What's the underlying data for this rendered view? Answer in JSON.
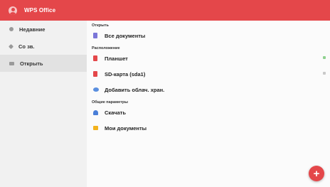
{
  "app": {
    "title": "WPS Office",
    "accent": "#e4474a"
  },
  "sidebar": {
    "items": [
      {
        "label": "Недавние",
        "icon": "clock-icon"
      },
      {
        "label": "Со зв.",
        "icon": "star-icon"
      },
      {
        "label": "Открыть",
        "icon": "folder-icon",
        "active": true
      }
    ]
  },
  "main": {
    "open_section": {
      "header": "Открыть",
      "items": [
        {
          "label": "Все документы",
          "icon": "documents-icon"
        }
      ]
    },
    "location_section": {
      "header": "Расположение",
      "items": [
        {
          "label": "Планшет",
          "icon": "tablet-icon"
        },
        {
          "label": "SD-карта (sda1)",
          "icon": "sd-card-icon"
        },
        {
          "label": "Добавить облач. хран.",
          "icon": "cloud-icon"
        }
      ]
    },
    "general_section": {
      "header": "Общие параметры",
      "items": [
        {
          "label": "Скачать",
          "icon": "download-icon"
        },
        {
          "label": "Мои документы",
          "icon": "my-documents-folder-icon"
        }
      ]
    }
  },
  "fab": {
    "label": "+",
    "icon": "plus-icon"
  }
}
